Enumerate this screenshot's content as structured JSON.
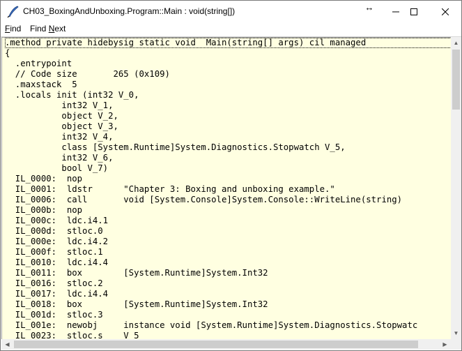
{
  "window": {
    "title": "CH03_BoxingAndUnboxing.Program::Main : void(string[])",
    "resize_glyph": "↔",
    "controls": {
      "minimize": "minimize",
      "maximize": "maximize",
      "close": "close"
    }
  },
  "menu": {
    "find": {
      "label_underline": "F",
      "label_rest": "ind"
    },
    "find_next": {
      "label_pre": "Find ",
      "label_underline": "N",
      "label_rest": "ext"
    }
  },
  "code_lines": [
    ".method private hidebysig static void  Main(string[] args) cil managed",
    "{",
    "  .entrypoint",
    "  // Code size       265 (0x109)",
    "  .maxstack  5",
    "  .locals init (int32 V_0,",
    "           int32 V_1,",
    "           object V_2,",
    "           object V_3,",
    "           int32 V_4,",
    "           class [System.Runtime]System.Diagnostics.Stopwatch V_5,",
    "           int32 V_6,",
    "           bool V_7)",
    "  IL_0000:  nop",
    "  IL_0001:  ldstr      \"Chapter 3: Boxing and unboxing example.\"",
    "  IL_0006:  call       void [System.Console]System.Console::WriteLine(string)",
    "  IL_000b:  nop",
    "  IL_000c:  ldc.i4.1",
    "  IL_000d:  stloc.0",
    "  IL_000e:  ldc.i4.2",
    "  IL_000f:  stloc.1",
    "  IL_0010:  ldc.i4.4",
    "  IL_0011:  box        [System.Runtime]System.Int32",
    "  IL_0016:  stloc.2",
    "  IL_0017:  ldc.i4.4",
    "  IL_0018:  box        [System.Runtime]System.Int32",
    "  IL_001d:  stloc.3",
    "  IL_001e:  newobj     instance void [System.Runtime]System.Diagnostics.Stopwatc",
    "  IL_0023:  stloc.s    V_5"
  ],
  "scroll": {
    "vertical_position": 0.0,
    "horizontal_position": 0.0
  },
  "colors": {
    "editor_background": "#ffffe1",
    "title_bar": "#ffffff",
    "scrollbar": "#f0f0f0"
  }
}
